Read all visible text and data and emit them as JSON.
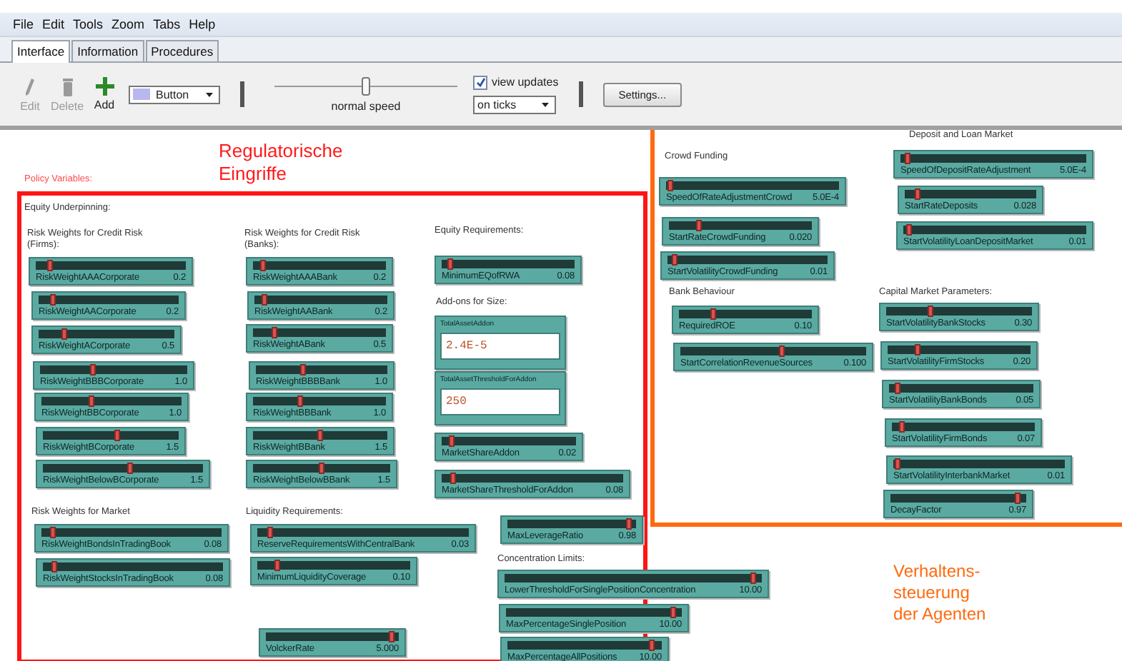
{
  "menu": [
    "File",
    "Edit",
    "Tools",
    "Zoom",
    "Tabs",
    "Help"
  ],
  "tabs": [
    {
      "label": "Interface",
      "selected": true
    },
    {
      "label": "Information",
      "selected": false
    },
    {
      "label": "Procedures",
      "selected": false
    }
  ],
  "toolbar": {
    "tools": [
      {
        "label": "Edit",
        "kind": "pencil",
        "disabled": true
      },
      {
        "label": "Delete",
        "kind": "trash",
        "disabled": true
      },
      {
        "label": "Add",
        "kind": "plus",
        "disabled": false
      }
    ],
    "widget_type": "Button",
    "speed": {
      "label": "normal speed",
      "level": 0.5
    },
    "view_updates": {
      "label": "view updates",
      "checked": true
    },
    "update_mode": "on ticks",
    "settings": "Settings..."
  },
  "widgets": [
    {
      "kind": "label",
      "text": "Policy Variables:",
      "color": "#ff4a4a"
    },
    {
      "kind": "label",
      "text": "Equity Underpinning:",
      "color": "#333333"
    },
    {
      "kind": "label",
      "text": "Risk Weights for Credit Risk (Firms):",
      "color": "#333333"
    },
    {
      "kind": "label",
      "text": "Risk Weights for Credit Risk (Banks):",
      "color": "#333333"
    },
    {
      "kind": "label",
      "text": "Equity Requirements:",
      "color": "#333333"
    },
    {
      "kind": "slider",
      "name": "RiskWeightAAACorporate",
      "value": "0.2",
      "level": 0.08
    },
    {
      "kind": "slider",
      "name": "RiskWeightAACorporate",
      "value": "0.2",
      "level": 0.08
    },
    {
      "kind": "slider",
      "name": "RiskWeightACorporate",
      "value": "0.5",
      "level": 0.18
    },
    {
      "kind": "slider",
      "name": "RiskWeightBBBCorporate",
      "value": "1.0",
      "level": 0.35
    },
    {
      "kind": "slider",
      "name": "RiskWeightBBCorporate",
      "value": "1.0",
      "level": 0.35
    },
    {
      "kind": "slider",
      "name": "RiskWeightBCorporate",
      "value": "1.5",
      "level": 0.55
    },
    {
      "kind": "slider",
      "name": "RiskWeightBelowBCorporate",
      "value": "1.5",
      "level": 0.55
    },
    {
      "kind": "slider",
      "name": "RiskWeightAAABank",
      "value": "0.2",
      "level": 0.06
    },
    {
      "kind": "slider",
      "name": "RiskWeightAABank",
      "value": "0.2",
      "level": 0.06
    },
    {
      "kind": "slider",
      "name": "RiskWeightABank",
      "value": "0.5",
      "level": 0.15
    },
    {
      "kind": "slider",
      "name": "RiskWeightBBBBank",
      "value": "1.0",
      "level": 0.35
    },
    {
      "kind": "slider",
      "name": "RiskWeightBBBank",
      "value": "1.0",
      "level": 0.35
    },
    {
      "kind": "slider",
      "name": "RiskWeightBBank",
      "value": "1.5",
      "level": 0.5
    },
    {
      "kind": "slider",
      "name": "RiskWeightBelowBBank",
      "value": "1.5",
      "level": 0.5
    },
    {
      "kind": "slider",
      "name": "MinimumEQofRWA",
      "value": "0.08",
      "level": 0.05
    },
    {
      "kind": "label",
      "text": "Add-ons for Size:",
      "color": "#333333"
    },
    {
      "kind": "input",
      "name": "TotalAssetAddon",
      "value": "2.4E-5"
    },
    {
      "kind": "input",
      "name": "TotalAssetThresholdForAddon",
      "value": "250"
    },
    {
      "kind": "slider",
      "name": "MarketShareAddon",
      "value": "0.02",
      "level": 0.05
    },
    {
      "kind": "slider",
      "name": "MarketShareThresholdForAddon",
      "value": "0.08",
      "level": 0.05
    },
    {
      "kind": "label",
      "text": "Risk Weights for Market",
      "color": "#333333"
    },
    {
      "kind": "label",
      "text": "Liquidity Requirements:",
      "color": "#333333"
    },
    {
      "kind": "slider",
      "name": "MaxLeverageRatio",
      "value": "0.98",
      "level": 0.97
    },
    {
      "kind": "slider",
      "name": "RiskWeightBondsInTradingBook",
      "value": "0.08",
      "level": 0.05
    },
    {
      "kind": "slider",
      "name": "ReserveRequirementsWithCentralBank",
      "value": "0.03",
      "level": 0.05
    },
    {
      "kind": "slider",
      "name": "RiskWeightStocksInTradingBook",
      "value": "0.08",
      "level": 0.05
    },
    {
      "kind": "slider",
      "name": "MinimumLiquidityCoverage",
      "value": "0.10",
      "level": 0.12
    },
    {
      "kind": "label",
      "text": "Concentration Limits:",
      "color": "#333333"
    },
    {
      "kind": "slider",
      "name": "LowerThresholdForSinglePositionConcentration",
      "value": "10.00",
      "level": 0.98
    },
    {
      "kind": "slider",
      "name": "MaxPercentageSinglePosition",
      "value": "10.00",
      "level": 0.97
    },
    {
      "kind": "slider",
      "name": "VolckerRate",
      "value": "5.000",
      "level": 0.97
    },
    {
      "kind": "slider",
      "name": "MaxPercentageAllPositions",
      "value": "10.00",
      "level": 0.95
    },
    {
      "kind": "label",
      "text": "Deposit and Loan Market",
      "color": "#333333"
    },
    {
      "kind": "label",
      "text": "Crowd Funding",
      "color": "#333333"
    },
    {
      "kind": "slider",
      "name": "SpeedOfDepositRateAdjustment",
      "value": "5.0E-4",
      "level": 0.02
    },
    {
      "kind": "slider",
      "name": "SpeedOfRateAdjustmentCrowd",
      "value": "5.0E-4",
      "level": 0.01
    },
    {
      "kind": "slider",
      "name": "StartRateDeposits",
      "value": "0.028",
      "level": 0.08
    },
    {
      "kind": "slider",
      "name": "StartRateCrowdFunding",
      "value": "0.020",
      "level": 0.2
    },
    {
      "kind": "slider",
      "name": "StartVolatilityLoanDepositMarket",
      "value": "0.01",
      "level": 0.02
    },
    {
      "kind": "slider",
      "name": "StartVolatilityCrowdFunding",
      "value": "0.01",
      "level": 0.03
    },
    {
      "kind": "label",
      "text": "Bank Behaviour",
      "color": "#333333"
    },
    {
      "kind": "label",
      "text": "Capital Market Parameters:",
      "color": "#333333"
    },
    {
      "kind": "slider",
      "name": "RequiredROE",
      "value": "0.10",
      "level": 0.25
    },
    {
      "kind": "slider",
      "name": "StartVolatilityBankStocks",
      "value": "0.30",
      "level": 0.3
    },
    {
      "kind": "slider",
      "name": "StartCorrelationRevenueSources",
      "value": "0.100",
      "level": 0.55
    },
    {
      "kind": "slider",
      "name": "StartVolatilityFirmStocks",
      "value": "0.20",
      "level": 0.2
    },
    {
      "kind": "slider",
      "name": "StartVolatilityBankBonds",
      "value": "0.05",
      "level": 0.04
    },
    {
      "kind": "slider",
      "name": "StartVolatilityFirmBonds",
      "value": "0.07",
      "level": 0.05
    },
    {
      "kind": "slider",
      "name": "StartVolatilityInterbankMarket",
      "value": "0.01",
      "level": 0.01
    },
    {
      "kind": "slider",
      "name": "DecayFactor",
      "value": "0.97",
      "level": 0.96
    }
  ],
  "annotations": [
    {
      "kind": "regulation",
      "lines": [
        "Regulatorische",
        "Eingriffe"
      ]
    },
    {
      "kind": "behaviour",
      "lines": [
        "Verhaltens-",
        "steuerung",
        "der Agenten"
      ]
    }
  ]
}
